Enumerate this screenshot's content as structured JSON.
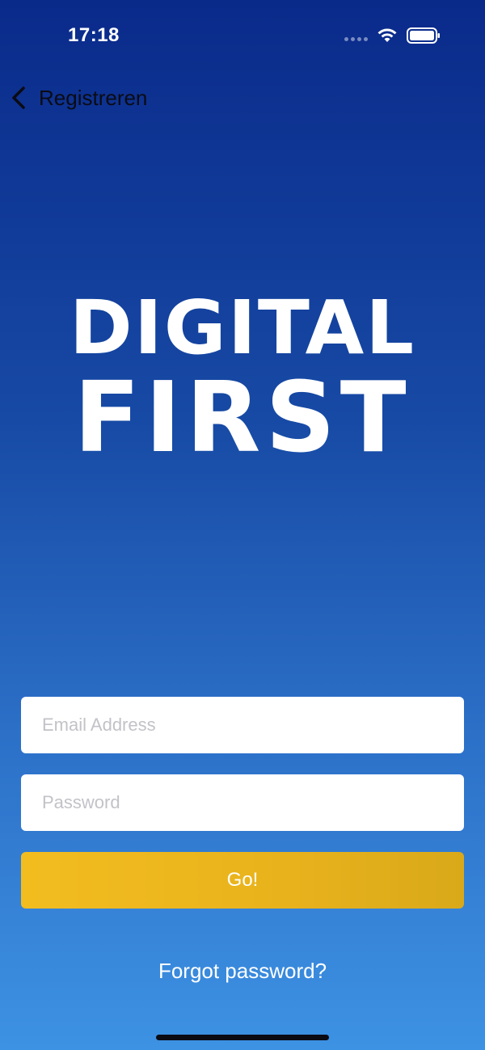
{
  "status_bar": {
    "time": "17:18",
    "icons": [
      "cellular-dots-icon",
      "wifi-icon",
      "battery-icon"
    ]
  },
  "nav": {
    "back_label": "Registreren",
    "back_icon": "chevron-left-icon"
  },
  "logo": {
    "line1": "DIGITAL",
    "line2": "FIRST"
  },
  "form": {
    "email_placeholder": "Email Address",
    "email_value": "",
    "password_placeholder": "Password",
    "password_value": "",
    "submit_label": "Go!"
  },
  "links": {
    "forgot_password": "Forgot password?"
  },
  "colors": {
    "background_top": "#0a2a8a",
    "background_bottom": "#3d92e3",
    "button_accent": "#f2bd1f",
    "field_background": "#ffffff"
  }
}
